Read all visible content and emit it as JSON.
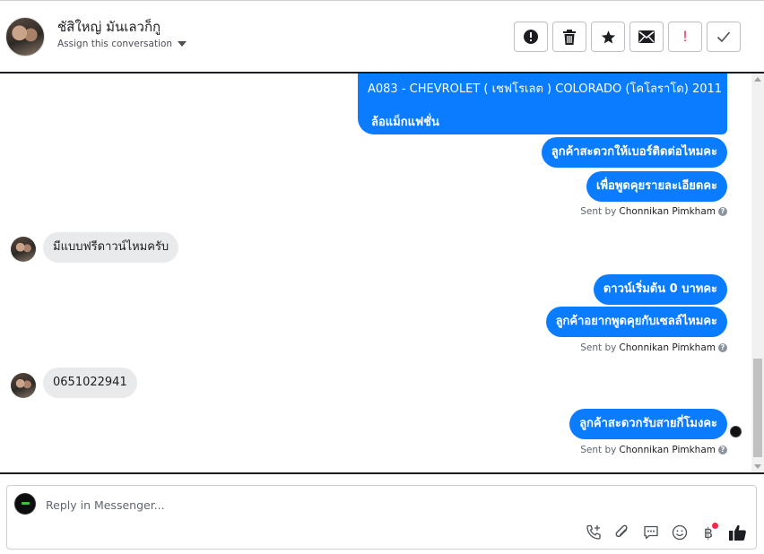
{
  "header": {
    "contact_name": "ชัสิใหญ่ มันเลวก็กู",
    "assign_label": "Assign this conversation",
    "actions": [
      {
        "icon": "alert-circle-icon",
        "name": "spam-button"
      },
      {
        "icon": "trash-icon",
        "name": "delete-button"
      },
      {
        "icon": "star-icon",
        "name": "star-button"
      },
      {
        "icon": "envelope-icon",
        "name": "mark-unread-button"
      },
      {
        "icon": "exclamation-icon",
        "name": "follow-up-button",
        "glyph": "!"
      },
      {
        "icon": "check-icon",
        "name": "done-button"
      }
    ]
  },
  "messages": {
    "out1_line1": "A083 - CHEVROLET ( เชฟโรเลต ) COLORADO (โคโลราโด) 2011",
    "out1_line2": "ล้อแม็กแฟชั่น",
    "out2": "ลูกค้าสะดวกให้เบอร์ติดต่อไหมคะ",
    "out3": "เพื่อพูดคุยรายละเอียดคะ",
    "sent_by_prefix": "Sent by",
    "sent_by_name": "Chonnikan Pimkham",
    "help_glyph": "?",
    "in1": "มีแบบฟรีดาวน์ไหมครับ",
    "out4": "ดาวน์เริ่มต้น 0 บาทคะ",
    "out5": "ลูกค้าอยากพูดคุยกับเซลล์ไหมคะ",
    "in2": "0651022941",
    "out6": "ลูกค้าสะดวกรับสายกี่โมงคะ"
  },
  "reply": {
    "placeholder": "Reply in Messenger...",
    "tools": [
      "call-add-icon",
      "paperclip-icon",
      "saved-reply-icon",
      "emoji-icon",
      "baht-icon",
      "thumbs-up-icon"
    ],
    "baht_glyph": "฿"
  },
  "colors": {
    "outgoing": "#0a7cff",
    "incoming": "#e9eaec",
    "notification": "#f02849"
  }
}
